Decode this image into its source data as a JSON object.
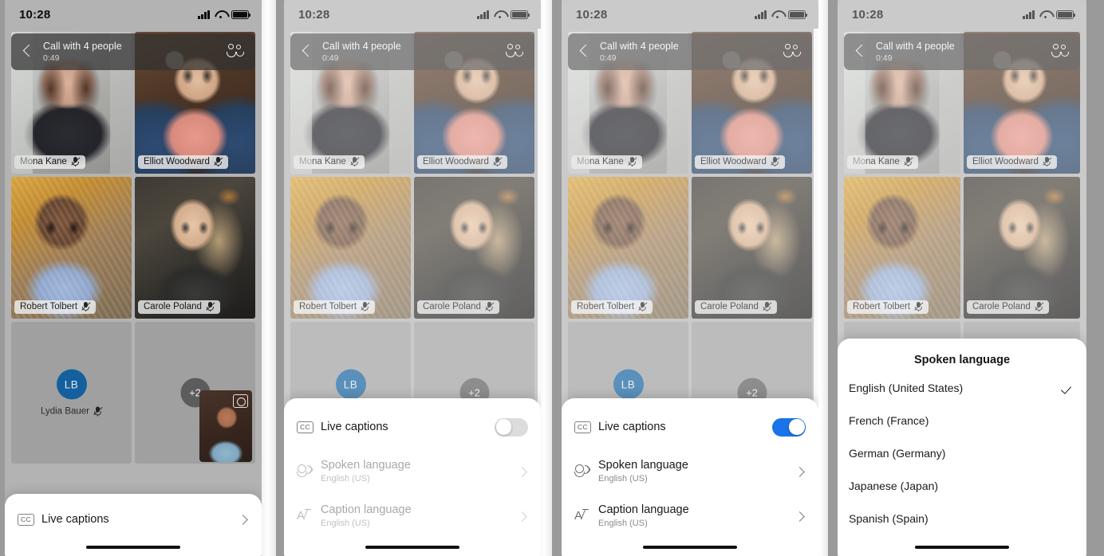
{
  "status_bar": {
    "time": "10:28",
    "icons": [
      "cellular-signal-icon",
      "wifi-icon",
      "battery-icon"
    ]
  },
  "call_header": {
    "back_icon": "chevron-left-icon",
    "title": "Call with 4 people",
    "timer": "0:49",
    "people_icon": "people-icon"
  },
  "participants": [
    {
      "name": "Mona Kane",
      "muted": true,
      "tile": "video"
    },
    {
      "name": "Elliot Woodward",
      "muted": true,
      "tile": "video"
    },
    {
      "name": "Robert Tolbert",
      "muted": true,
      "tile": "video"
    },
    {
      "name": "Carole Poland",
      "muted": true,
      "tile": "video"
    },
    {
      "name": "Lydia Bauer",
      "muted": true,
      "tile": "avatar",
      "initials": "LB"
    },
    {
      "name": "",
      "muted": false,
      "tile": "overflow",
      "overflow_label": "+2"
    }
  ],
  "self_view": {
    "flip_icon": "flip-camera-icon"
  },
  "panels": [
    {
      "id": "panel-collapsed-sheet",
      "sheet": {
        "type": "collapsed",
        "rows": [
          {
            "icon": "cc-icon",
            "title": "Live captions",
            "accessory": "chevron-right-icon",
            "dimmed": false
          }
        ]
      }
    },
    {
      "id": "panel-captions-off",
      "sheet": {
        "type": "expanded",
        "rows": [
          {
            "icon": "cc-icon",
            "title": "Live captions",
            "accessory": "toggle-off",
            "dimmed": false
          },
          {
            "icon": "spoken-language-icon",
            "title": "Spoken language",
            "subtitle": "English (US)",
            "accessory": "chevron-right-icon",
            "dimmed": true
          },
          {
            "icon": "caption-language-icon",
            "title": "Caption language",
            "subtitle": "English (US)",
            "accessory": "chevron-right-icon",
            "dimmed": true
          }
        ]
      }
    },
    {
      "id": "panel-captions-on",
      "sheet": {
        "type": "expanded",
        "rows": [
          {
            "icon": "cc-icon",
            "title": "Live captions",
            "accessory": "toggle-on",
            "dimmed": false
          },
          {
            "icon": "spoken-language-icon",
            "title": "Spoken language",
            "subtitle": "English (US)",
            "accessory": "chevron-right-icon",
            "dimmed": false
          },
          {
            "icon": "caption-language-icon",
            "title": "Caption language",
            "subtitle": "English (US)",
            "accessory": "chevron-right-icon",
            "dimmed": false
          }
        ]
      }
    },
    {
      "id": "panel-language-picker",
      "sheet": {
        "type": "dialog",
        "title": "Spoken language",
        "options": [
          {
            "label": "English (United States)",
            "selected": true
          },
          {
            "label": "French (France)",
            "selected": false
          },
          {
            "label": "German (Germany)",
            "selected": false
          },
          {
            "label": "Japanese (Japan)",
            "selected": false
          },
          {
            "label": "Spanish (Spain)",
            "selected": false
          }
        ]
      }
    }
  ],
  "colors": {
    "toggle_on": "#1a73e8",
    "toggle_off": "#dcdcdc",
    "avatar": "#14609e",
    "end_call_button": "#8d2430",
    "sheet_background": "#ffffff",
    "screen_background": "#b3b3b3"
  }
}
